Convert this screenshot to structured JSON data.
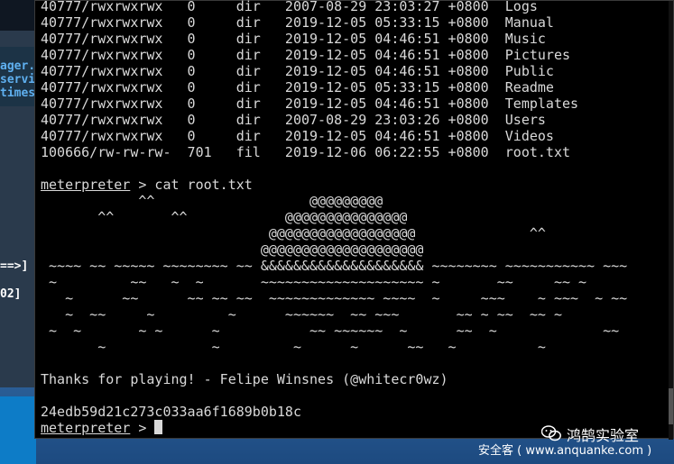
{
  "background_window": {
    "lines_blue": [
      "ager.",
      "servi",
      "times"
    ],
    "line_progress": "==>]",
    "line_num": "02]"
  },
  "terminal": {
    "lines": [
      "40777/rwxrwxrwx   0     dir   2007-08-29 23:03:27 +0800  Logs",
      "40777/rwxrwxrwx   0     dir   2019-12-05 05:33:15 +0800  Manual",
      "40777/rwxrwxrwx   0     dir   2019-12-05 04:46:51 +0800  Music",
      "40777/rwxrwxrwx   0     dir   2019-12-05 04:46:51 +0800  Pictures",
      "40777/rwxrwxrwx   0     dir   2019-12-05 04:46:51 +0800  Public",
      "40777/rwxrwxrwx   0     dir   2019-12-05 05:33:15 +0800  Readme",
      "40777/rwxrwxrwx   0     dir   2019-12-05 04:46:51 +0800  Templates",
      "40777/rwxrwxrwx   0     dir   2007-08-29 23:03:26 +0800  Users",
      "40777/rwxrwxrwx   0     dir   2019-12-05 04:46:51 +0800  Videos",
      "100666/rw-rw-rw-  701   fil   2019-12-06 06:22:55 +0800  root.txt",
      "",
      "",
      "            ^^                   @@@@@@@@@",
      "       ^^       ^^            @@@@@@@@@@@@@@@",
      "                            @@@@@@@@@@@@@@@@@@              ^^",
      "                           @@@@@@@@@@@@@@@@@@@@",
      " ~~~~ ~~ ~~~~~ ~~~~~~~~ ~~ &&&&&&&&&&&&&&&&&&&& ~~~~~~~~ ~~~~~~~~~~~ ~~~",
      " ~         ~~   ~  ~       ~~~~~~~~~~~~~~~~~~~~ ~       ~~     ~~ ~",
      "   ~      ~~      ~~ ~~ ~~  ~~~~~~~~~~~~~ ~~~~  ~     ~~~    ~ ~~~  ~ ~~",
      "   ~  ~~     ~         ~      ~~~~~~  ~~ ~~~       ~~ ~ ~~  ~~ ~",
      " ~  ~       ~ ~      ~           ~~ ~~~~~~  ~      ~~  ~             ~~",
      "       ~             ~         ~      ~      ~~   ~          ~",
      "",
      "Thanks for playing! - Felipe Winsnes (@whitecr0wz)",
      "",
      "24edb59d21c273c033aa6f1689b0b18c"
    ],
    "prompt1_keyword": "meterpreter",
    "prompt1_rest": " > cat root.txt",
    "prompt2_keyword": "meterpreter",
    "prompt2_rest": " > "
  },
  "watermark": {
    "title": "鸿鹄实验室",
    "subtitle": "安全客 ( www.anquanke.com )",
    "icon": "wechat-icon"
  }
}
